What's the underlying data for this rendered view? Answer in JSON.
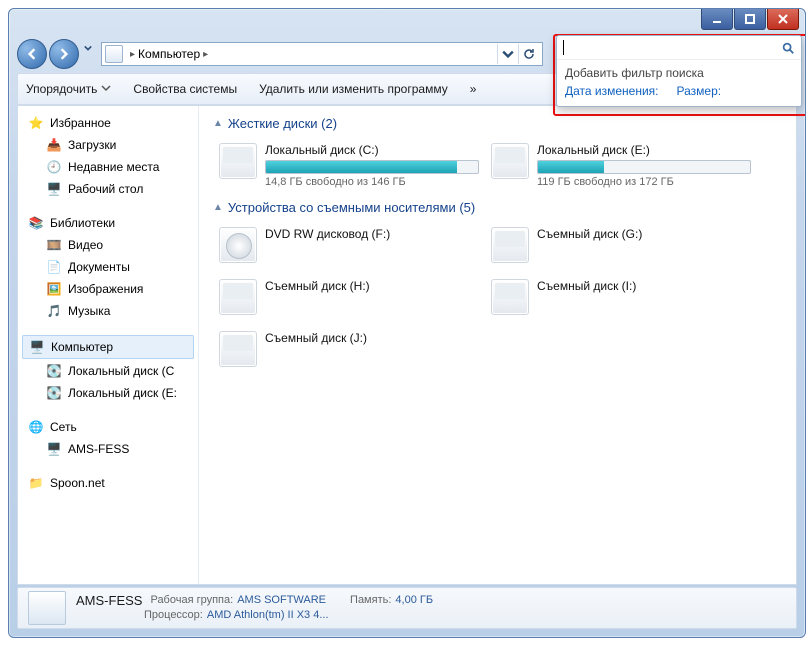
{
  "window_controls": {
    "min": "minimize",
    "max": "maximize",
    "close": "close"
  },
  "nav": {
    "location_root": "Компьютер",
    "search_placeholder": ""
  },
  "search_popup": {
    "title": "Добавить фильтр поиска",
    "link_date": "Дата изменения:",
    "link_size": "Размер:"
  },
  "toolbar": {
    "organize": "Упорядочить",
    "properties": "Свойства системы",
    "programs": "Удалить или изменить программу",
    "overflow": "»"
  },
  "sidebar": {
    "favorites": "Избранное",
    "downloads": "Загрузки",
    "recent": "Недавние места",
    "desktop": "Рабочий стол",
    "libraries": "Библиотеки",
    "videos": "Видео",
    "documents": "Документы",
    "pictures": "Изображения",
    "music": "Музыка",
    "computer": "Компьютер",
    "drive_c": "Локальный диск (С",
    "drive_e": "Локальный диск (E:",
    "network": "Сеть",
    "host": "AMS-FESS",
    "spoon": "Spoon.net"
  },
  "main": {
    "hdd_header": "Жесткие диски (2)",
    "drive_c": {
      "name": "Локальный диск (C:)",
      "free": "14,8 ГБ свободно из 146 ГБ",
      "pct": 90
    },
    "drive_e": {
      "name": "Локальный диск (E:)",
      "free": "119 ГБ свободно из 172 ГБ",
      "pct": 31
    },
    "rem_header": "Устройства со съемными носителями (5)",
    "dvd": {
      "name": "DVD RW дисковод (F:)"
    },
    "g": {
      "name": "Съемный диск (G:)"
    },
    "h": {
      "name": "Съемный диск (H:)"
    },
    "i": {
      "name": "Съемный диск (I:)"
    },
    "j": {
      "name": "Съемный диск (J:)"
    }
  },
  "status": {
    "title": "AMS-FESS",
    "workgroup_lbl": "Рабочая группа:",
    "workgroup": "AMS SOFTWARE",
    "mem_lbl": "Память:",
    "mem": "4,00 ГБ",
    "cpu_lbl": "Процессор:",
    "cpu": "AMD Athlon(tm) II X3 4..."
  }
}
